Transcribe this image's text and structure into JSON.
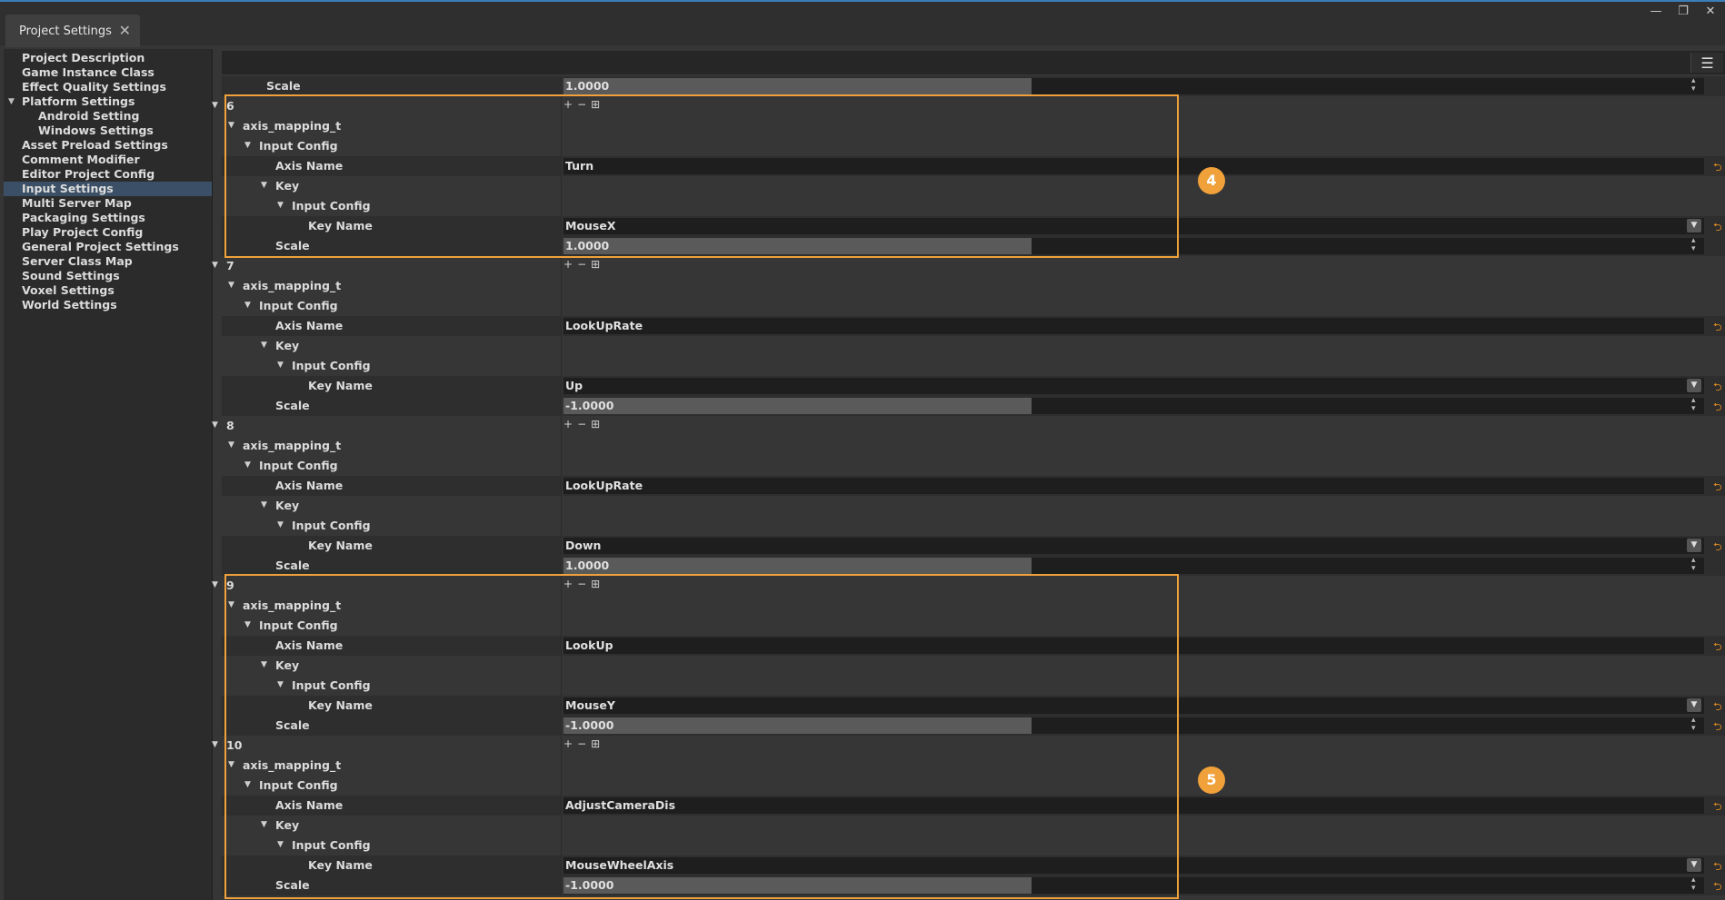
{
  "window": {
    "tab_title": "Project Settings",
    "close_glyph": "✕",
    "controls": [
      "—",
      "❐",
      "✕"
    ]
  },
  "sidebar": {
    "items": [
      {
        "label": "Project Description",
        "indent": 0
      },
      {
        "label": "Game Instance Class",
        "indent": 0
      },
      {
        "label": "Effect Quality Settings",
        "indent": 0
      },
      {
        "label": "Platform Settings",
        "indent": 0,
        "expanded": true
      },
      {
        "label": "Android Setting",
        "indent": 1
      },
      {
        "label": "Windows Settings",
        "indent": 1
      },
      {
        "label": "Asset Preload Settings",
        "indent": 0
      },
      {
        "label": "Comment Modifier",
        "indent": 0
      },
      {
        "label": "Editor Project Config",
        "indent": 0
      },
      {
        "label": "Input Settings",
        "indent": 0,
        "selected": true
      },
      {
        "label": "Multi Server Map",
        "indent": 0
      },
      {
        "label": "Packaging Settings",
        "indent": 0
      },
      {
        "label": "Play Project Config",
        "indent": 0
      },
      {
        "label": "General Project Settings",
        "indent": 0
      },
      {
        "label": "Server Class Map",
        "indent": 0
      },
      {
        "label": "Sound Settings",
        "indent": 0
      },
      {
        "label": "Voxel Settings",
        "indent": 0
      },
      {
        "label": "World Settings",
        "indent": 0
      }
    ]
  },
  "toolbar": {
    "menu_icon": "☰"
  },
  "labels": {
    "scale": "Scale",
    "axis_mapping": "axis_mapping_t",
    "input_config": "Input Config",
    "axis_name": "Axis Name",
    "key": "Key",
    "key_name": "Key Name"
  },
  "icons": {
    "add": "+",
    "remove": "−",
    "insert": "⊞",
    "reset": "⮌",
    "spin": "▲▼",
    "dropdown": "▼",
    "expand": "▼"
  },
  "top_scale": {
    "value": "1.0000",
    "fill": 0.41
  },
  "mappings": [
    {
      "index": "6",
      "axis_name": "Turn",
      "key_name": "MouseX",
      "scale": "1.0000",
      "scale_fill": 0.41,
      "reset": false
    },
    {
      "index": "7",
      "axis_name": "LookUpRate",
      "key_name": "Up",
      "scale": "-1.0000",
      "scale_fill": 0.41,
      "reset": true
    },
    {
      "index": "8",
      "axis_name": "LookUpRate",
      "key_name": "Down",
      "scale": "1.0000",
      "scale_fill": 0.41,
      "reset": false
    },
    {
      "index": "9",
      "axis_name": "LookUp",
      "key_name": "MouseY",
      "scale": "-1.0000",
      "scale_fill": 0.41,
      "reset": true
    },
    {
      "index": "10",
      "axis_name": "AdjustCameraDis",
      "key_name": "MouseWheelAxis",
      "scale": "-1.0000",
      "scale_fill": 0.41,
      "reset": true
    }
  ],
  "annotations": [
    {
      "number": "4",
      "color": "#f0a13a"
    },
    {
      "number": "5",
      "color": "#f0a13a"
    }
  ]
}
